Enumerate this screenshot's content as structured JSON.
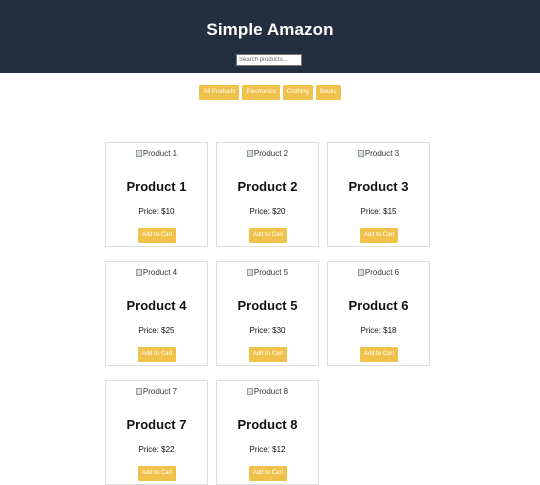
{
  "header": {
    "title": "Simple Amazon",
    "search_placeholder": "Search products..."
  },
  "filters": [
    "All Products",
    "Electronics",
    "Clothing",
    "Books"
  ],
  "products": [
    {
      "image_alt": "Product 1",
      "name": "Product 1",
      "price": "Price: $10",
      "button": "Add to Cart"
    },
    {
      "image_alt": "Product 2",
      "name": "Product 2",
      "price": "Price: $20",
      "button": "Add to Cart"
    },
    {
      "image_alt": "Product 3",
      "name": "Product 3",
      "price": "Price: $15",
      "button": "Add to Cart"
    },
    {
      "image_alt": "Product 4",
      "name": "Product 4",
      "price": "Price: $25",
      "button": "Add to Cart"
    },
    {
      "image_alt": "Product 5",
      "name": "Product 5",
      "price": "Price: $30",
      "button": "Add to Cart"
    },
    {
      "image_alt": "Product 6",
      "name": "Product 6",
      "price": "Price: $18",
      "button": "Add to Cart"
    },
    {
      "image_alt": "Product 7",
      "name": "Product 7",
      "price": "Price: $22",
      "button": "Add to Cart"
    },
    {
      "image_alt": "Product 8",
      "name": "Product 8",
      "price": "Price: $12",
      "button": "Add to Cart"
    }
  ],
  "colors": {
    "header_bg": "#232f3e",
    "accent": "#f0c14b"
  }
}
